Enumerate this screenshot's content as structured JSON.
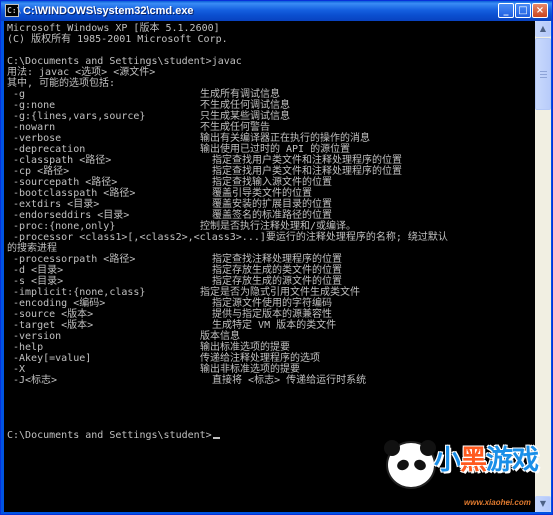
{
  "window": {
    "title": "C:\\WINDOWS\\system32\\cmd.exe",
    "icon": "cmd-icon",
    "controls": {
      "minimize": "_",
      "maximize": "□",
      "close": "×"
    }
  },
  "console": {
    "lines": [
      {
        "text": "Microsoft Windows XP [版本 5.1.2600]"
      },
      {
        "text": "(C) 版权所有 1985-2001 Microsoft Corp."
      },
      {
        "text": ""
      },
      {
        "text": "C:\\Documents and Settings\\student>javac"
      },
      {
        "text": "用法: javac <选项> <源文件>"
      },
      {
        "text": "其中, 可能的选项包括:"
      },
      {
        "opt": "-g",
        "desc": "生成所有调试信息"
      },
      {
        "opt": "-g:none",
        "desc": "不生成任何调试信息"
      },
      {
        "opt": "-g:{lines,vars,source}",
        "desc": "只生成某些调试信息"
      },
      {
        "opt": "-nowarn",
        "desc": "不生成任何警告"
      },
      {
        "opt": "-verbose",
        "desc": "输出有关编译器正在执行的操作的消息"
      },
      {
        "opt": "-deprecation",
        "desc": "输出使用已过时的 API 的源位置"
      },
      {
        "opt": "-classpath <路径>",
        "desc": "  指定查找用户类文件和注释处理程序的位置"
      },
      {
        "opt": "-cp <路径>",
        "desc": "  指定查找用户类文件和注释处理程序的位置"
      },
      {
        "opt": "-sourcepath <路径>",
        "desc": "  指定查找输入源文件的位置"
      },
      {
        "opt": "-bootclasspath <路径>",
        "desc": "  覆盖引导类文件的位置"
      },
      {
        "opt": "-extdirs <目录>",
        "desc": "  覆盖安装的扩展目录的位置"
      },
      {
        "opt": "-endorseddirs <目录>",
        "desc": "  覆盖签名的标准路径的位置"
      },
      {
        "opt": "-proc:{none,only}",
        "desc": "控制是否执行注释处理和/或编译。"
      },
      {
        "text": " -processor <class1>[,<class2>,<class3>...]要运行的注释处理程序的名称; 绕过默认"
      },
      {
        "text": "的搜索进程"
      },
      {
        "opt": "-processorpath <路径>",
        "desc": "  指定查找注释处理程序的位置"
      },
      {
        "opt": "-d <目录>",
        "desc": "  指定存放生成的类文件的位置"
      },
      {
        "opt": "-s <目录>",
        "desc": "  指定存放生成的源文件的位置"
      },
      {
        "opt": "-implicit:{none,class}",
        "desc": "指定是否为隐式引用文件生成类文件"
      },
      {
        "opt": "-encoding <编码>",
        "desc": "  指定源文件使用的字符编码"
      },
      {
        "opt": "-source <版本>",
        "desc": "  提供与指定版本的源兼容性"
      },
      {
        "opt": "-target <版本>",
        "desc": "  生成特定 VM 版本的类文件"
      },
      {
        "opt": "-version",
        "desc": "版本信息"
      },
      {
        "opt": "-help",
        "desc": "输出标准选项的提要"
      },
      {
        "opt": "-Akey[=value]",
        "desc": "传递给注释处理程序的选项"
      },
      {
        "opt": "-X",
        "desc": "输出非标准选项的提要"
      },
      {
        "opt": "-J<标志>",
        "desc": "  直接将 <标志> 传递给运行时系统"
      },
      {
        "text": ""
      },
      {
        "text": ""
      },
      {
        "text": ""
      },
      {
        "text": ""
      },
      {
        "text": "C:\\Documents and Settings\\student>"
      }
    ],
    "text_color": "#c0c0c0",
    "background": "#000000"
  },
  "watermark": {
    "logo_text_1": "小",
    "logo_text_2": "黑",
    "logo_text_3": "游戏",
    "url": "www.xiaohei.com",
    "colors": {
      "blue": "#1a8fe8",
      "orange": "#ff5a1f"
    }
  }
}
